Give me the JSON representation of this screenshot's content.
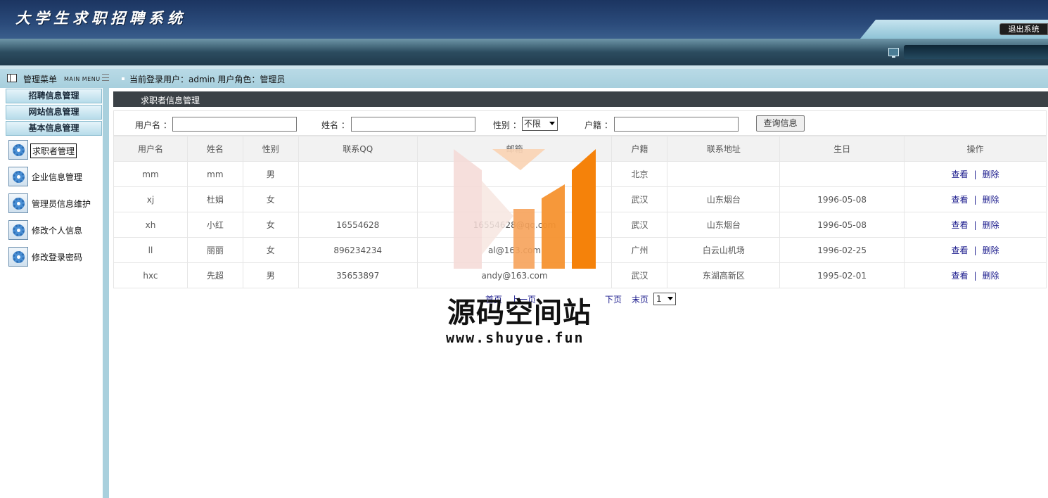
{
  "header": {
    "title": "大学生求职招聘系统",
    "logout_label": "退出系统"
  },
  "subbar": {
    "menu_title": "管理菜单",
    "menu_title_en": "MAIN MENU",
    "user_info": "当前登录用户：admin  用户角色：管理员"
  },
  "sidebar": {
    "groups": [
      "招聘信息管理",
      "网站信息管理",
      "基本信息管理"
    ],
    "items": [
      {
        "label": "求职者管理",
        "active": true
      },
      {
        "label": "企业信息管理"
      },
      {
        "label": "管理员信息维护"
      },
      {
        "label": "修改个人信息"
      },
      {
        "label": "修改登录密码"
      }
    ]
  },
  "main": {
    "title": "求职者信息管理",
    "search": {
      "username_label": "用户名 ：",
      "username_value": "",
      "name_label": "姓名 ：",
      "name_value": "",
      "gender_label": "性别 ：",
      "gender_selected": "不限",
      "hometown_label": "户籍 ：",
      "hometown_value": "",
      "query_button": "查询信息"
    },
    "table": {
      "columns": [
        "用户名",
        "姓名",
        "性别",
        "联系QQ",
        "邮箱",
        "户籍",
        "联系地址",
        "生日",
        "操作"
      ],
      "rows": [
        [
          "mm",
          "mm",
          "男",
          "",
          "",
          "北京",
          "",
          ""
        ],
        [
          "xj",
          "杜娟",
          "女",
          "",
          "",
          "武汉",
          "山东烟台",
          "1996-05-08"
        ],
        [
          "xh",
          "小红",
          "女",
          "16554628",
          "16554628@qq.com",
          "武汉",
          "山东烟台",
          "1996-05-08"
        ],
        [
          "ll",
          "丽丽",
          "女",
          "896234234",
          "al@163.com",
          "广州",
          "白云山机场",
          "1996-02-25"
        ],
        [
          "hxc",
          "先超",
          "男",
          "35653897",
          "andy@163.com",
          "武汉",
          "东湖高新区",
          "1995-02-01"
        ]
      ],
      "op_view": "查看",
      "op_sep": "|",
      "op_delete": "删除"
    },
    "pager": {
      "first": "首页",
      "prev": "上一页",
      "next": "下页",
      "last": "末页",
      "page_selected": "1"
    }
  },
  "watermark": {
    "title": "源码空间站",
    "url": "www.shuyue.fun"
  }
}
